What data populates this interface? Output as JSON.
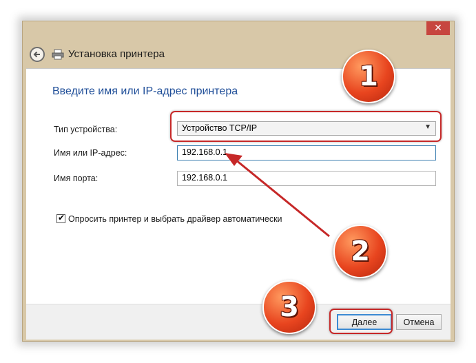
{
  "window": {
    "title": "Установка принтера",
    "close_label": "✕"
  },
  "content": {
    "heading": "Введите имя или IP-адрес принтера",
    "device_type_label": "Тип устройства:",
    "device_type_value": "Устройство TCP/IP",
    "hostname_label": "Имя или IP-адрес:",
    "hostname_value": "192.168.0.1",
    "port_label": "Имя порта:",
    "port_value": "192.168.0.1",
    "query_printer_label": "Опросить принтер и выбрать драйвер автоматически",
    "query_printer_checked": true
  },
  "footer": {
    "next_label": "Далее",
    "cancel_label": "Отмена"
  },
  "annotations": {
    "badge_1": "1",
    "badge_2": "2",
    "badge_3": "3",
    "highlight_color": "#c62828",
    "badge_color": "#e8451f"
  },
  "icons": {
    "back": "back-arrow-icon",
    "printer": "printer-icon",
    "dropdown": "chevron-down-icon",
    "checkmark": "checkmark-icon"
  }
}
